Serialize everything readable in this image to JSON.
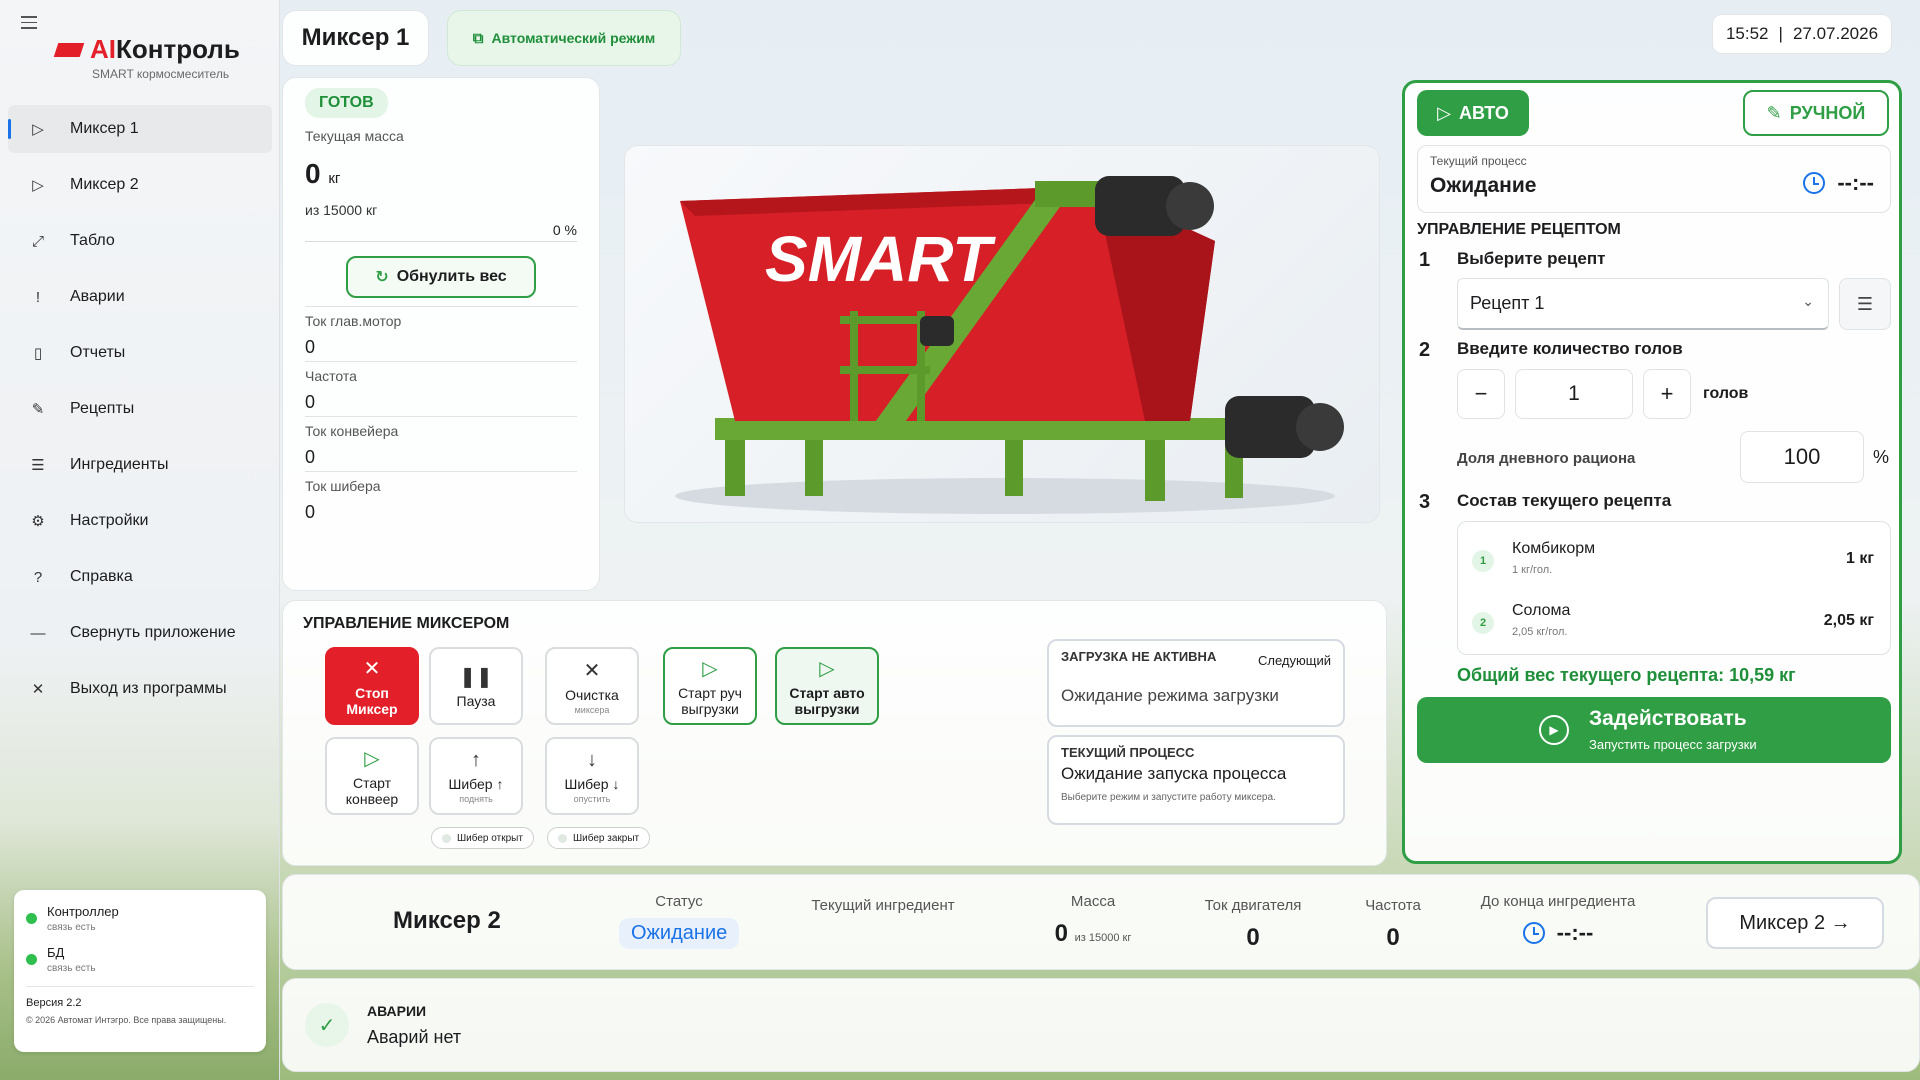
{
  "app": {
    "logo_ai": "AI",
    "logo_rest": "Контроль",
    "subtitle": "SMART кормосмеситель"
  },
  "sidebar": {
    "items": [
      {
        "label": "Миксер 1",
        "icon": "play-icon"
      },
      {
        "label": "Миксер 2",
        "icon": "play-icon"
      },
      {
        "label": "Табло",
        "icon": "expand-icon"
      },
      {
        "label": "Аварии",
        "icon": "alarm-icon"
      },
      {
        "label": "Отчеты",
        "icon": "document-icon"
      },
      {
        "label": "Рецепты",
        "icon": "pencil-icon"
      },
      {
        "label": "Ингредиенты",
        "icon": "list-icon"
      },
      {
        "label": "Настройки",
        "icon": "gear-icon"
      },
      {
        "label": "Справка",
        "icon": "question-icon"
      },
      {
        "label": "Свернуть приложение",
        "icon": "minimize-icon"
      },
      {
        "label": "Выход из программы",
        "icon": "close-icon"
      }
    ],
    "status": {
      "controller": {
        "name": "Контроллер",
        "sub": "связь есть"
      },
      "db": {
        "name": "БД",
        "sub": "связь есть"
      },
      "version": "Версия 2.2",
      "copyright": "© 2026 Автомат Интэгро. Все права защищены."
    }
  },
  "header": {
    "title": "Миксер 1",
    "mode": "Автоматический режим",
    "time": "15:52",
    "date": "27.07.2026"
  },
  "mass": {
    "status": "ГОТОВ",
    "label": "Текущая масса",
    "value": "0",
    "unit": "кг",
    "of": "из 15000 кг",
    "percent": "0 %",
    "reset": "Обнулить вес",
    "metrics": [
      {
        "label": "Ток глав.мотор",
        "value": "0"
      },
      {
        "label": "Частота",
        "value": "0"
      },
      {
        "label": "Ток конвейера",
        "value": "0"
      },
      {
        "label": "Ток шибера",
        "value": "0"
      }
    ]
  },
  "image": {
    "brand": "SMART"
  },
  "control": {
    "title": "УПРАВЛЕНИЕ МИКСЕРОМ",
    "stop": {
      "line1": "Стоп",
      "line2": "Миксер"
    },
    "pause": "Пауза",
    "clean": {
      "label": "Очистка",
      "sub": "миксера"
    },
    "start_manual": {
      "line1": "Старт руч",
      "line2": "выгрузки"
    },
    "start_auto": {
      "line1": "Старт авто",
      "line2": "выгрузки"
    },
    "start_conveyor": {
      "line1": "Старт",
      "line2": "конвеер"
    },
    "gate_up": {
      "label": "Шибер ↑",
      "sub": "поднять"
    },
    "gate_down": {
      "label": "Шибер ↓",
      "sub": "опустить"
    },
    "gate_open": "Шибер открыт",
    "gate_closed": "Шибер закрыт",
    "load_box": {
      "head": "ЗАГРУЗКА НЕ АКТИВНА",
      "next": "Следующий",
      "main": "Ожидание режима загрузки"
    },
    "process_box": {
      "head": "ТЕКУЩИЙ ПРОЦЕСС",
      "main": "Ожидание запуска процесса",
      "sub": "Выберите режим и запустите работу миксера."
    }
  },
  "mixer2": {
    "title": "Миксер 2",
    "status_h": "Статус",
    "status_v": "Ожидание",
    "ingredient_h": "Текущий ингредиент",
    "mass_h": "Масса",
    "mass_v": "0",
    "mass_of": "из 15000 кг",
    "motor_h": "Ток двигателя",
    "motor_v": "0",
    "freq_h": "Частота",
    "freq_v": "0",
    "end_h": "До конца ингредиента",
    "end_v": "--:--",
    "button": "Миксер 2 →"
  },
  "alarms": {
    "title": "АВАРИИ",
    "text": "Аварий нет"
  },
  "right": {
    "auto": "АВТО",
    "manual": "РУЧНОЙ",
    "process_h": "Текущий процесс",
    "process_v": "Ожидание",
    "process_time": "--:--",
    "recipe_title": "УПРАВЛЕНИЕ РЕЦЕПТОМ",
    "step1": "Выберите рецепт",
    "recipe_selected": "Рецепт 1",
    "step2": "Введите количество голов",
    "heads_value": "1",
    "heads_unit": "голов",
    "ratio_label": "Доля дневного рациона",
    "ratio_value": "100",
    "ratio_unit": "%",
    "step3": "Состав текущего рецепта",
    "ingredients": [
      {
        "n": "1",
        "name": "Комбикорм",
        "per": "1 кг/гол.",
        "kg": "1 кг"
      },
      {
        "n": "2",
        "name": "Солома",
        "per": "2,05 кг/гол.",
        "kg": "2,05 кг"
      }
    ],
    "total": "Общий вес текущего рецепта: 10,59 кг",
    "apply": "Задействовать",
    "apply_sub": "Запустить процесс загрузки"
  }
}
